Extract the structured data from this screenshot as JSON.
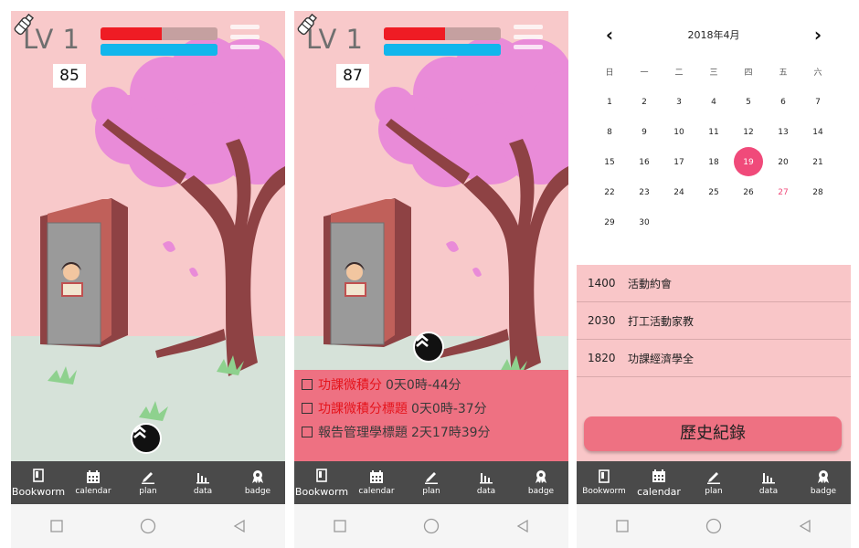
{
  "game": {
    "level_label": "LV 1",
    "hp_fraction": 0.52,
    "xp_fraction": 1.0,
    "screen1": {
      "milk_count": "85"
    },
    "screen2": {
      "milk_count": "87"
    }
  },
  "tasks": [
    {
      "name": "功課微積分",
      "remaining": "0天0時-44分",
      "urgent": true
    },
    {
      "name": "功課微積分標題",
      "remaining": "0天0時-37分",
      "urgent": true
    },
    {
      "name": "報告管理學標題",
      "remaining": "2天17時39分",
      "urgent": false
    }
  ],
  "tabbar": {
    "tabs": [
      {
        "label": "Bookworm",
        "icon": "book-icon"
      },
      {
        "label": "calendar",
        "icon": "calendar-icon"
      },
      {
        "label": "plan",
        "icon": "pencil-icon"
      },
      {
        "label": "data",
        "icon": "bar-chart-icon"
      },
      {
        "label": "badge",
        "icon": "badge-icon"
      }
    ]
  },
  "calendar": {
    "title": "2018年4月",
    "prev_symbol": "‹",
    "next_symbol": "›",
    "weekdays": [
      "日",
      "一",
      "二",
      "三",
      "四",
      "五",
      "六"
    ],
    "weeks": [
      [
        "1",
        "2",
        "3",
        "4",
        "5",
        "6",
        "7"
      ],
      [
        "8",
        "9",
        "10",
        "11",
        "12",
        "13",
        "14"
      ],
      [
        "15",
        "16",
        "17",
        "18",
        "19",
        "20",
        "21"
      ],
      [
        "22",
        "23",
        "24",
        "25",
        "26",
        "27",
        "28"
      ],
      [
        "29",
        "30",
        "",
        "",
        "",
        "",
        ""
      ]
    ],
    "selected_day": "19",
    "highlight_day": "27",
    "selected_color": "#f04a7a"
  },
  "events": [
    {
      "time": "1400",
      "title": "活動約會"
    },
    {
      "time": "2030",
      "title": "打工活動家教"
    },
    {
      "time": "1820",
      "title": "功課經濟學全"
    }
  ],
  "history_button": "歷史紀錄",
  "colors": {
    "sky": "#f8c9ca",
    "ground": "#d6e2d9",
    "blossom": "#e98bd8",
    "trunk": "#8e4244",
    "task_panel": "#ee7182",
    "tabbar": "#4a4a4a"
  }
}
